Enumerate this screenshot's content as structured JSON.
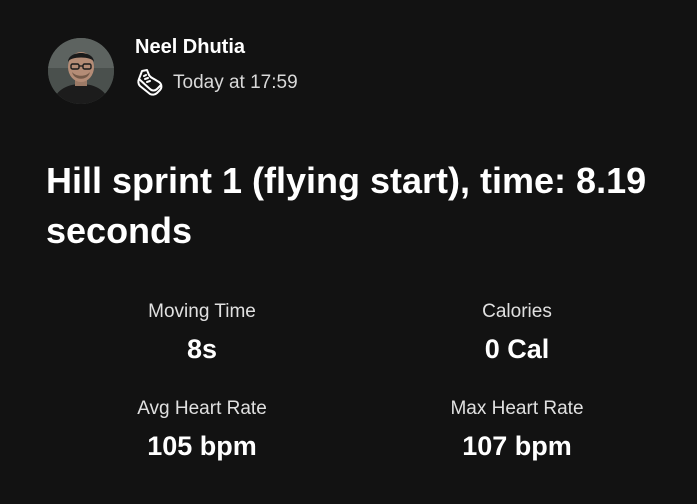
{
  "athlete": {
    "name": "Neel Dhutia",
    "activity_icon": "running-shoe-icon",
    "timestamp": "Today at 17:59"
  },
  "activity": {
    "title": "Hill sprint 1 (flying start), time: 8.19 seconds"
  },
  "stats": [
    {
      "label": "Moving Time",
      "value": "8s"
    },
    {
      "label": "Calories",
      "value": "0 Cal"
    },
    {
      "label": "Avg Heart Rate",
      "value": "105 bpm"
    },
    {
      "label": "Max Heart Rate",
      "value": "107 bpm"
    }
  ],
  "colors": {
    "background": "#121212",
    "text_primary": "#ffffff",
    "text_secondary": "#d9d9d9"
  }
}
